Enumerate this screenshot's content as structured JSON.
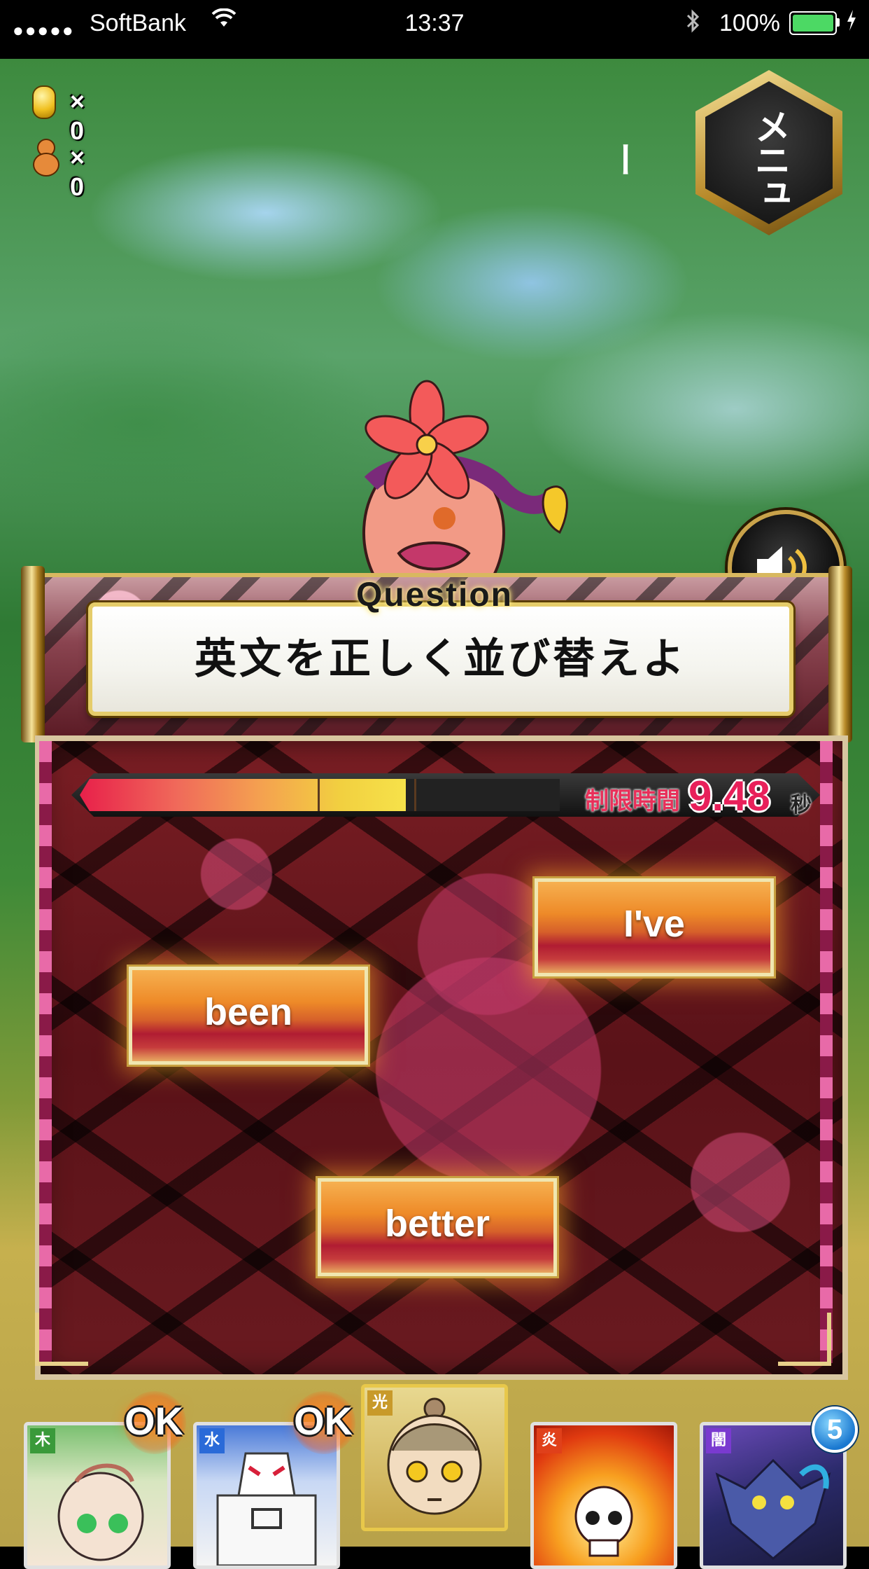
{
  "status_bar": {
    "carrier": "SoftBank",
    "time": "13:37",
    "battery": "100%"
  },
  "counters": {
    "coins": "× 0",
    "gourds": "× 0"
  },
  "menu": {
    "label": "メニュー"
  },
  "question": {
    "tag": "Question",
    "prompt": "英文を正しく並び替えよ"
  },
  "timer": {
    "label": "制限時間",
    "value": "9.48",
    "unit": "秒",
    "remaining_fraction": 0.68
  },
  "words": [
    "I've",
    "been",
    "better"
  ],
  "party": {
    "cards": [
      {
        "element": "木",
        "status": "OK"
      },
      {
        "element": "水",
        "status": "OK"
      },
      {
        "element": "光",
        "status": ""
      },
      {
        "element": "炎",
        "status": ""
      },
      {
        "element": "闇",
        "status": ""
      }
    ],
    "badge_count": "5"
  },
  "colors": {
    "timer_red": "#e8205a",
    "button_orange": "#ee8a28",
    "button_crimson": "#b01c32",
    "frame_gold": "#e5cc6a"
  }
}
